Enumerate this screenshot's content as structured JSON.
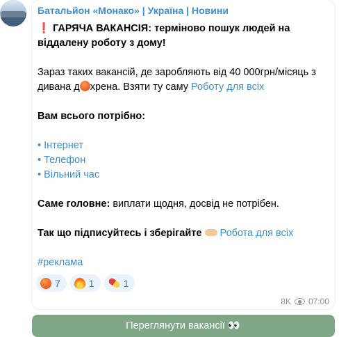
{
  "post": {
    "channel_title": "Батальйон «Монако» | Україна | Новини",
    "line1_bold": "ГАРЯЧА ВАКАНСІЯ: терміново пошук людей на віддалену роботу з дому!",
    "line2_pre": "Зараз таких вакансій, де заробляють від 40 000грн/місяць з дивана д",
    "line2_mid": "хрена. Взяти ту саму ",
    "line2_link": "Роботу для всіх",
    "line3_bold": "Вам всього потрібно:",
    "list": [
      "• Інтернет",
      "• Телефон",
      "• Вільний час"
    ],
    "line4_bold": "Саме головне:",
    "line4_rest": " виплати щодня, досвід не потрібен.",
    "line5_bold": "Так що підписуйтесь і зберігайте",
    "line5_link": "Робота для всіх",
    "hashtag": "#реклама"
  },
  "reactions": [
    {
      "icon": "angry-face-icon",
      "count": "7"
    },
    {
      "icon": "fire-icon",
      "count": "1"
    },
    {
      "icon": "pill-icon",
      "count": "1"
    }
  ],
  "meta": {
    "views": "8K",
    "time": "07:00"
  },
  "cta": {
    "label": "Переглянути вакансії",
    "emoji": "👀"
  }
}
